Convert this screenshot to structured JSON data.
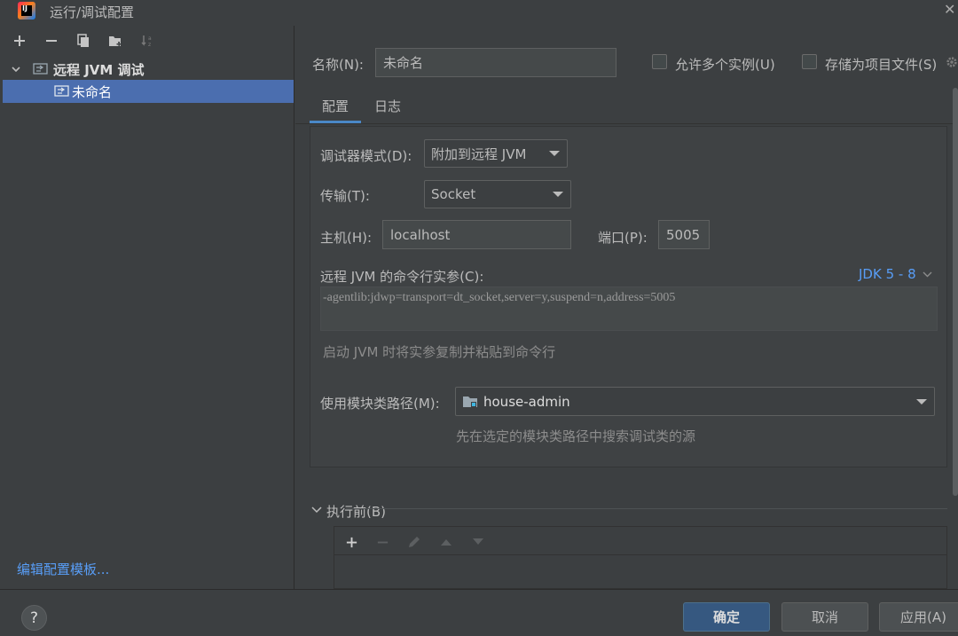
{
  "window": {
    "title": "运行/调试配置",
    "close_glyph": "✕"
  },
  "sidebar": {
    "tree": {
      "root_label": "远程 JVM 调试",
      "child_label": "未命名"
    },
    "edit_templates_link": "编辑配置模板..."
  },
  "header": {
    "name_label": "名称(N):",
    "name_value": "未命名",
    "allow_parallel_label": "允许多个实例(U)",
    "store_as_file_label": "存储为项目文件(S)"
  },
  "tabs": [
    {
      "label": "配置",
      "active": true
    },
    {
      "label": "日志",
      "active": false
    }
  ],
  "config": {
    "debugger_mode_label": "调试器模式(D):",
    "debugger_mode_value": "附加到远程 JVM",
    "transport_label": "传输(T):",
    "transport_value": "Socket",
    "host_label": "主机(H):",
    "host_value": "localhost",
    "port_label": "端口(P):",
    "port_value": "5005",
    "cmdline_label": "远程 JVM 的命令行实参(C):",
    "jdk_selector": "JDK 5 - 8",
    "cmdline_value": "-agentlib:jdwp=transport=dt_socket,server=y,suspend=n,address=5005",
    "cmdline_hint": "启动 JVM 时将实参复制并粘贴到命令行",
    "module_classpath_label": "使用模块类路径(M):",
    "module_classpath_value": "house-admin",
    "module_classpath_hint": "先在选定的模块类路径中搜索调试类的源"
  },
  "before_launch": {
    "label": "执行前(B)"
  },
  "buttons": {
    "help": "?",
    "ok": "确定",
    "cancel": "取消",
    "apply": "应用(A)"
  },
  "colors": {
    "background": "#3c3f41",
    "selection": "#4b6eaf",
    "link": "#589df6",
    "accent_tab": "#4a88c7",
    "default_button": "#365880"
  }
}
